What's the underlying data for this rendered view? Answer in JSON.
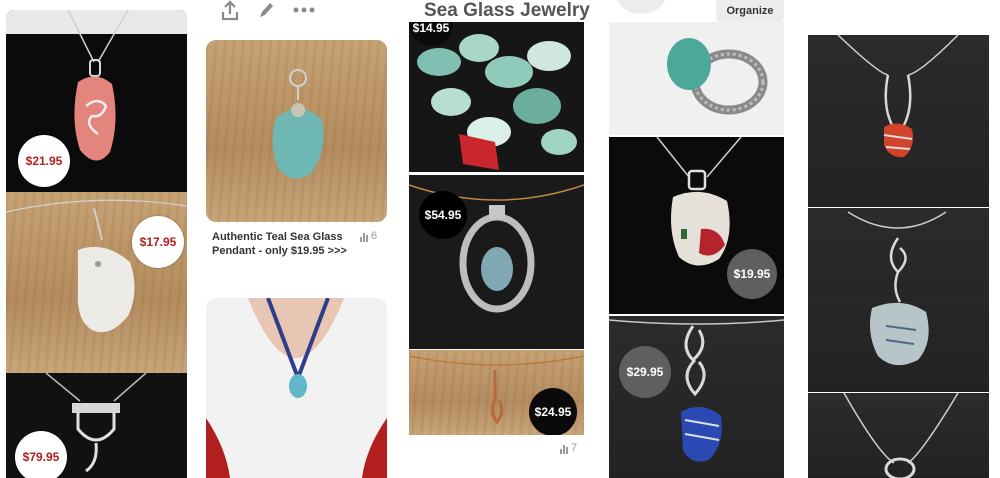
{
  "header": {
    "board_title": "Sea Glass Jewelry",
    "organize_label": "Organize"
  },
  "toolbar": {
    "share_icon": "upload-icon",
    "edit_icon": "pencil-icon",
    "more_icon": "ellipsis-icon"
  },
  "pins": {
    "col1": {
      "p1_price": "$21.95",
      "p2_price": "$17.95",
      "p3_price": "$79.95"
    },
    "col2": {
      "p1_caption": "Authentic Teal Sea Glass Pendant - only $19.95 >>>",
      "p1_count": "6"
    },
    "col3": {
      "p1_price": "$14.95",
      "p2_price": "$54.95",
      "p3_price": "$24.95",
      "count": "7"
    },
    "col4": {
      "p2_price": "$19.95",
      "p3_price": "$29.95"
    }
  },
  "colors": {
    "price_red": "#b0201e",
    "badge_dark": "#0a0a0a",
    "badge_gray": "#5f5f5f"
  }
}
